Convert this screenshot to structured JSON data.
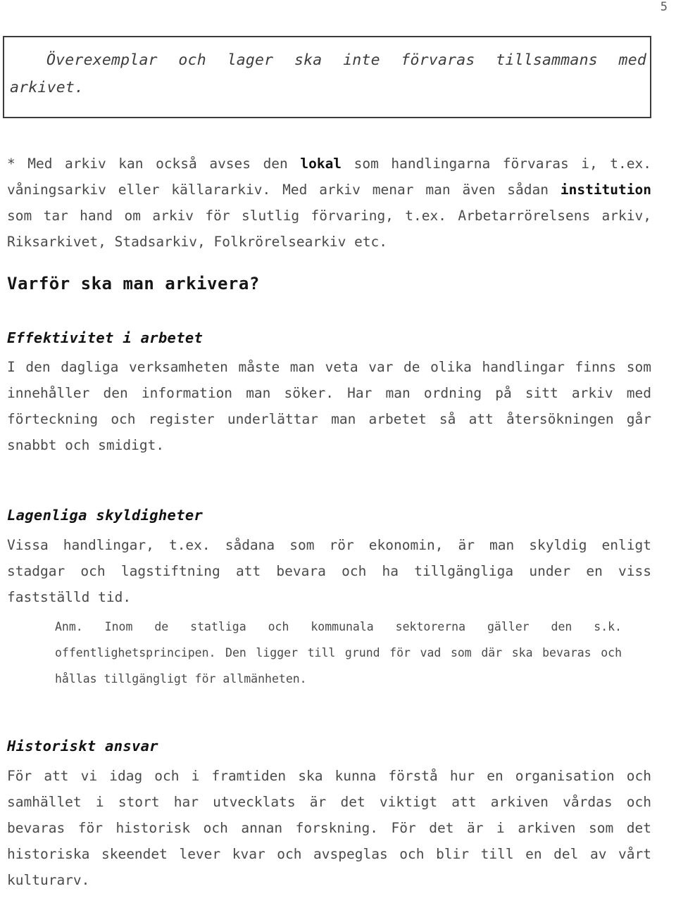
{
  "document": {
    "page_number": "5",
    "language": "sv"
  },
  "quote_box": {
    "text": "Överexemplar och lager ska inte förvaras tillsammans med arkivet."
  },
  "footnote": {
    "prefix": "* Med arkiv kan också avses den ",
    "bold_1": "lokal",
    "middle": " som handlingarna förvaras i, t.ex. våningsarkiv eller källararkiv.  Med arkiv menar man även sådan ",
    "bold_2": "institution",
    "suffix": " som tar hand om arkiv för slutlig förvaring, t.ex. Arbetarrörelsens arkiv, Riksarkivet, Stadsarkiv, Folkrörelsearkiv etc."
  },
  "sections": {
    "main_heading": "Varför ska man arkivera?",
    "effektivitet": {
      "heading": "Effektivitet i arbetet",
      "body": "I den dagliga verksamheten måste man veta var de olika handlingar finns som innehåller den information man söker. Har man ordning på sitt arkiv med förteckning och register underlättar man arbetet så att återsökningen går snabbt och smidigt."
    },
    "lagenliga": {
      "heading": "Lagenliga skyldigheter",
      "body": "Vissa handlingar, t.ex. sådana som rör ekonomin, är man skyldig enligt stadgar och lagstiftning att bevara och ha tillgängliga under en viss fastställd tid.",
      "note": "Anm. Inom de statliga och kommunala sektorerna gäller den s.k. offentlighetsprincipen. Den ligger till grund för  vad som där ska bevaras och hållas tillgängligt för allmänheten."
    },
    "historiskt": {
      "heading": "Historiskt ansvar",
      "body": "För att vi idag och i framtiden ska kunna förstå hur en organisation och samhället i stort har utvecklats är det viktigt att arkiven vårdas och bevaras för historisk och annan forskning. För det är i arkiven som det historiska skeendet lever kvar och avspeglas och blir till en del av vårt kulturarv."
    }
  },
  "colors": {
    "text": "#4a4a4a",
    "heading": "#161616",
    "box_border": "#3b3b3b",
    "page_background": "#ffffff"
  }
}
